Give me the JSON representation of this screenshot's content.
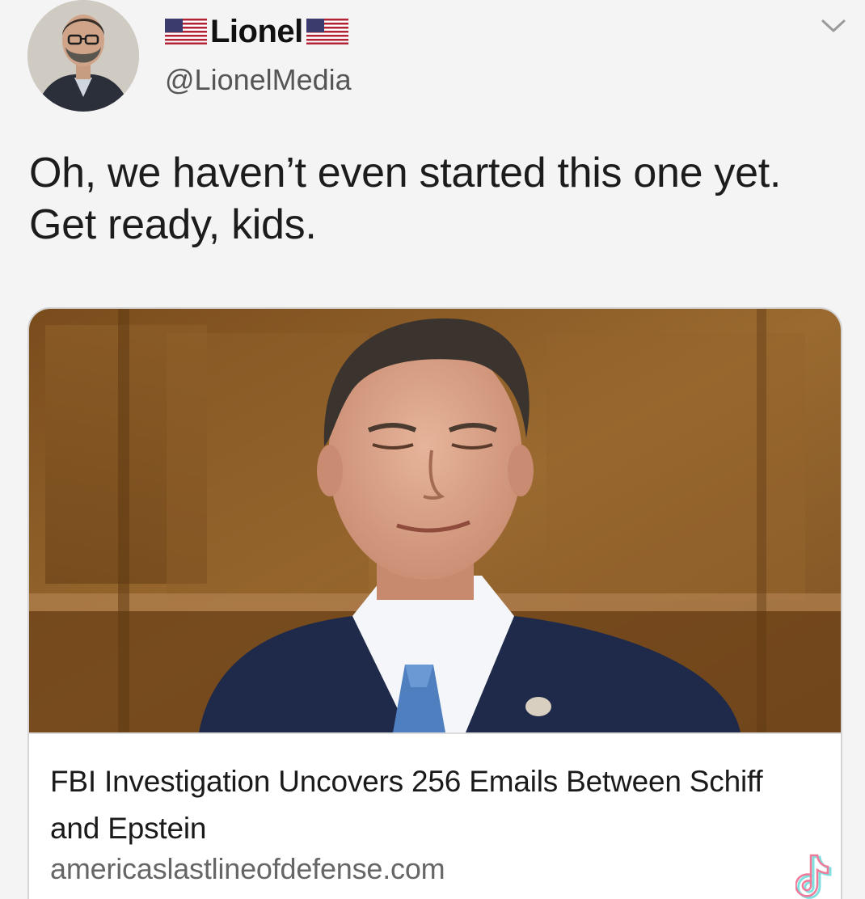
{
  "header": {
    "display_name": "Lionel",
    "handle": "@LionelMedia",
    "avatar_icon": "avatar-photo",
    "name_badges": [
      "us-flag-icon",
      "us-flag-icon"
    ],
    "menu_icon": "chevron-down-icon"
  },
  "tweet": {
    "text": "Oh, we haven’t even started this one yet. Get ready, kids."
  },
  "card": {
    "title": "FBI Investigation Uncovers 256 Emails Between Schiff and Epstein",
    "domain": "americaslastlineofdefense.com",
    "image_icon": "article-photo"
  },
  "overlay": {
    "watermark_icon": "tiktok-icon"
  },
  "colors": {
    "background": "#f4f4f4",
    "text": "#1c1c1c",
    "secondary_text": "#555555",
    "card_border": "#d4d4d4",
    "wood_panel": "#8a5a24"
  }
}
